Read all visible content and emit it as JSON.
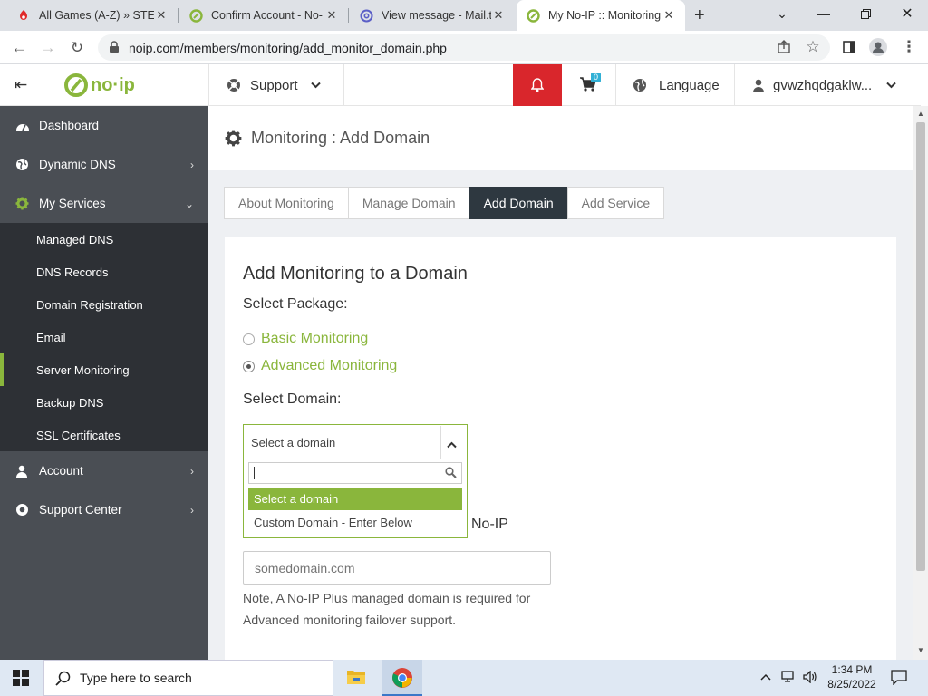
{
  "browser": {
    "tabs": [
      {
        "title": "All Games (A-Z) » STEAL",
        "favicon": "game-icon"
      },
      {
        "title": "Confirm Account - No-IP",
        "favicon": "noip-icon"
      },
      {
        "title": "View message - Mail.tm",
        "favicon": "mail-icon"
      },
      {
        "title": "My No-IP :: Monitoring",
        "favicon": "noip-icon"
      }
    ],
    "url": "noip.com/members/monitoring/add_monitor_domain.php"
  },
  "header": {
    "logo": "no·ip",
    "support_label": "Support",
    "cart_count": "0",
    "language_label": "Language",
    "username": "gvwzhqdgaklw..."
  },
  "sidebar": {
    "items": [
      {
        "label": "Dashboard"
      },
      {
        "label": "Dynamic DNS"
      },
      {
        "label": "My Services"
      },
      {
        "label": "Account"
      },
      {
        "label": "Support Center"
      }
    ],
    "sub_items": [
      {
        "label": "Managed DNS"
      },
      {
        "label": "DNS Records"
      },
      {
        "label": "Domain Registration"
      },
      {
        "label": "Email"
      },
      {
        "label": "Server Monitoring"
      },
      {
        "label": "Backup DNS"
      },
      {
        "label": "SSL Certificates"
      }
    ]
  },
  "page": {
    "title": "Monitoring : Add Domain",
    "tabs": [
      "About Monitoring",
      "Manage Domain",
      "Add Domain",
      "Add Service"
    ],
    "active_tab": "Add Domain"
  },
  "form": {
    "heading": "Add Monitoring to a Domain",
    "package_label": "Select Package:",
    "package_options": [
      "Basic Monitoring",
      "Advanced Monitoring"
    ],
    "selected_package": "Advanced Monitoring",
    "domain_label": "Select Domain:",
    "domain_select_value": "Select a domain",
    "dropdown_search_value": "",
    "dropdown_options": [
      "Select a domain",
      "Custom Domain - Enter Below"
    ],
    "highlighted_option": "Select a domain",
    "partial_label_suffix": "No-IP",
    "domain_input_placeholder": "somedomain.com",
    "note": "Note, A No-IP Plus managed domain is required for Advanced monitoring failover support."
  },
  "taskbar": {
    "search_placeholder": "Type here to search",
    "time": "1:34 PM",
    "date": "8/25/2022"
  },
  "colors": {
    "brand_green": "#8ab63c",
    "alert_red": "#d9262c",
    "sidebar_bg": "#4a4e54",
    "sidebar_sub_bg": "#2d3035",
    "active_tab_bg": "#2e3840",
    "cart_badge": "#31b0d5"
  }
}
